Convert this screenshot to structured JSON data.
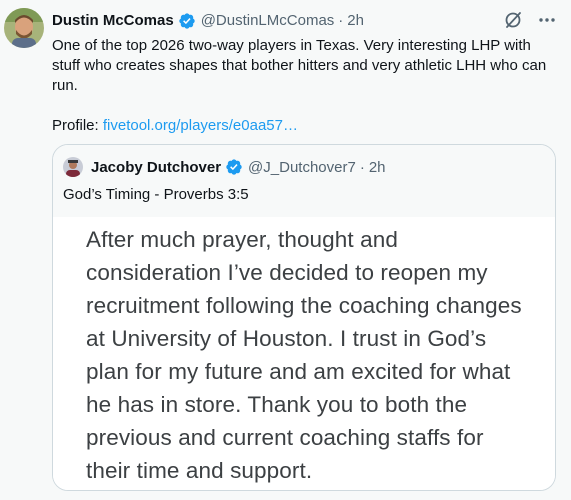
{
  "tweet": {
    "author_name": "Dustin McComas",
    "author_handle": "@DustinLMcComas",
    "separator": "·",
    "time": "2h",
    "body_line": "One of the top 2026 two-way players in Texas. Very interesting LHP with stuff who creates shapes that bother hitters and very athletic LHH who can run.",
    "profile_label": "Profile:",
    "profile_link": "fivetool.org/players/e0aa57…",
    "icons": {
      "verified": "verified-badge-icon",
      "grok": "grok-icon",
      "more": "more-options-icon"
    },
    "colors": {
      "accent": "#1d9bf0",
      "secondary_text": "#536471",
      "background": "#f7f9f9"
    }
  },
  "quote": {
    "author_name": "Jacoby Dutchover",
    "author_handle": "@J_Dutchover7",
    "separator": "·",
    "time": "2h",
    "caption": "God’s Timing - Proverbs 3:5",
    "image_text": "After much prayer, thought and consideration I’ve decided to reopen my recruitment following the coaching changes at University of Houston.  I trust in God’s plan for my future and am excited for what he has in store. Thank you to both the previous and current coaching staffs for their time and support."
  }
}
